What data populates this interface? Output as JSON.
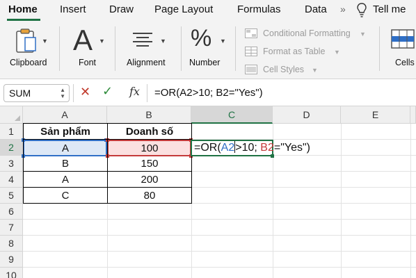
{
  "ribbon": {
    "tabs": [
      "Home",
      "Insert",
      "Draw",
      "Page Layout",
      "Formulas",
      "Data"
    ],
    "tell_me": "Tell me",
    "groups": {
      "clipboard": "Clipboard",
      "font": "Font",
      "alignment": "Alignment",
      "number": "Number",
      "cells": "Cells"
    },
    "styles": [
      "Conditional Formatting",
      "Format as Table",
      "Cell Styles"
    ]
  },
  "formula_bar": {
    "name_box": "SUM",
    "fx": "fx",
    "formula": "=OR(A2>10; B2=\"Yes\")"
  },
  "grid": {
    "columns": [
      "A",
      "B",
      "C",
      "D",
      "E"
    ],
    "rows": [
      "1",
      "2",
      "3",
      "4",
      "5",
      "6",
      "7",
      "8",
      "9",
      "10"
    ],
    "headers": [
      "Sản phẩm",
      "Doanh số"
    ],
    "data": [
      [
        "A",
        "100"
      ],
      [
        "B",
        "150"
      ],
      [
        "A",
        "200"
      ],
      [
        "C",
        "80"
      ]
    ],
    "editing": {
      "eq": "=OR(",
      "ref1": "A2",
      "mid": ">10; ",
      "ref2": "B2",
      "tail": "=\"Yes\")"
    }
  },
  "colors": {
    "accent": "#1f7244",
    "ref_blue": "#2f6fc6",
    "ref_red": "#c43a3a"
  }
}
